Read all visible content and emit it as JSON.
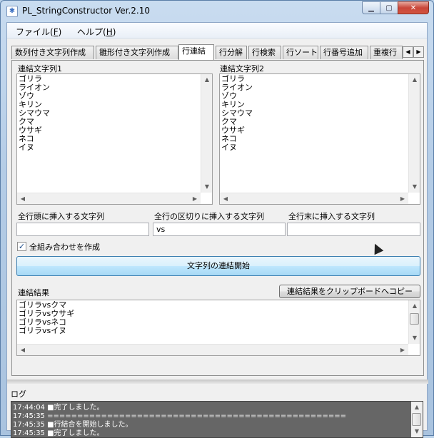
{
  "window": {
    "title": "PL_StringConstructor Ver.2.10",
    "min_label": "▁",
    "max_label": "▢",
    "close_label": "✕"
  },
  "menu": {
    "file_pre": "ファイル(",
    "file_key": "F",
    "file_post": ")",
    "help_pre": "ヘルプ(",
    "help_key": "H",
    "help_post": ")"
  },
  "tabs": [
    {
      "label": "数列付き文字列作成"
    },
    {
      "label": "雛形付き文字列作成"
    },
    {
      "label": "行連結"
    },
    {
      "label": "行分解"
    },
    {
      "label": "行検索"
    },
    {
      "label": "行ソート"
    },
    {
      "label": "行番号追加"
    },
    {
      "label": "重複行"
    }
  ],
  "panel": {
    "list1_label": "連結文字列1",
    "list2_label": "連結文字列2",
    "list1_text": "ゴリラ\nライオン\nゾウ\nキリン\nシマウマ\nクマ\nウサギ\nネコ\nイヌ",
    "list2_text": "ゴリラ\nライオン\nゾウ\nキリン\nシマウマ\nクマ\nウサギ\nネコ\nイヌ",
    "prefix_label": "全行頭に挿入する文字列",
    "separator_label": "全行の区切りに挿入する文字列",
    "suffix_label": "全行末に挿入する文字列",
    "prefix_value": "",
    "separator_value": "vs",
    "suffix_value": "",
    "combo_label": "全組み合わせを作成",
    "combo_check": "✓",
    "start_button": "文字列の連結開始",
    "result_label": "連結結果",
    "copy_button": "連結結果をクリップボードへコピー",
    "result_text": "ゴリラvsクマ\nゴリラvsウサギ\nゴリラvsネコ\nゴリラvsイヌ"
  },
  "log": {
    "label": "ログ",
    "text": "17:44:04 ■完了しました。\n17:45:35 ==================================================\n17:45:35 ■行結合を開始しました。\n17:45:35 ■完了しました。"
  },
  "icons": {
    "up": "▲",
    "down": "▼",
    "left": "◀",
    "right": "▶"
  }
}
